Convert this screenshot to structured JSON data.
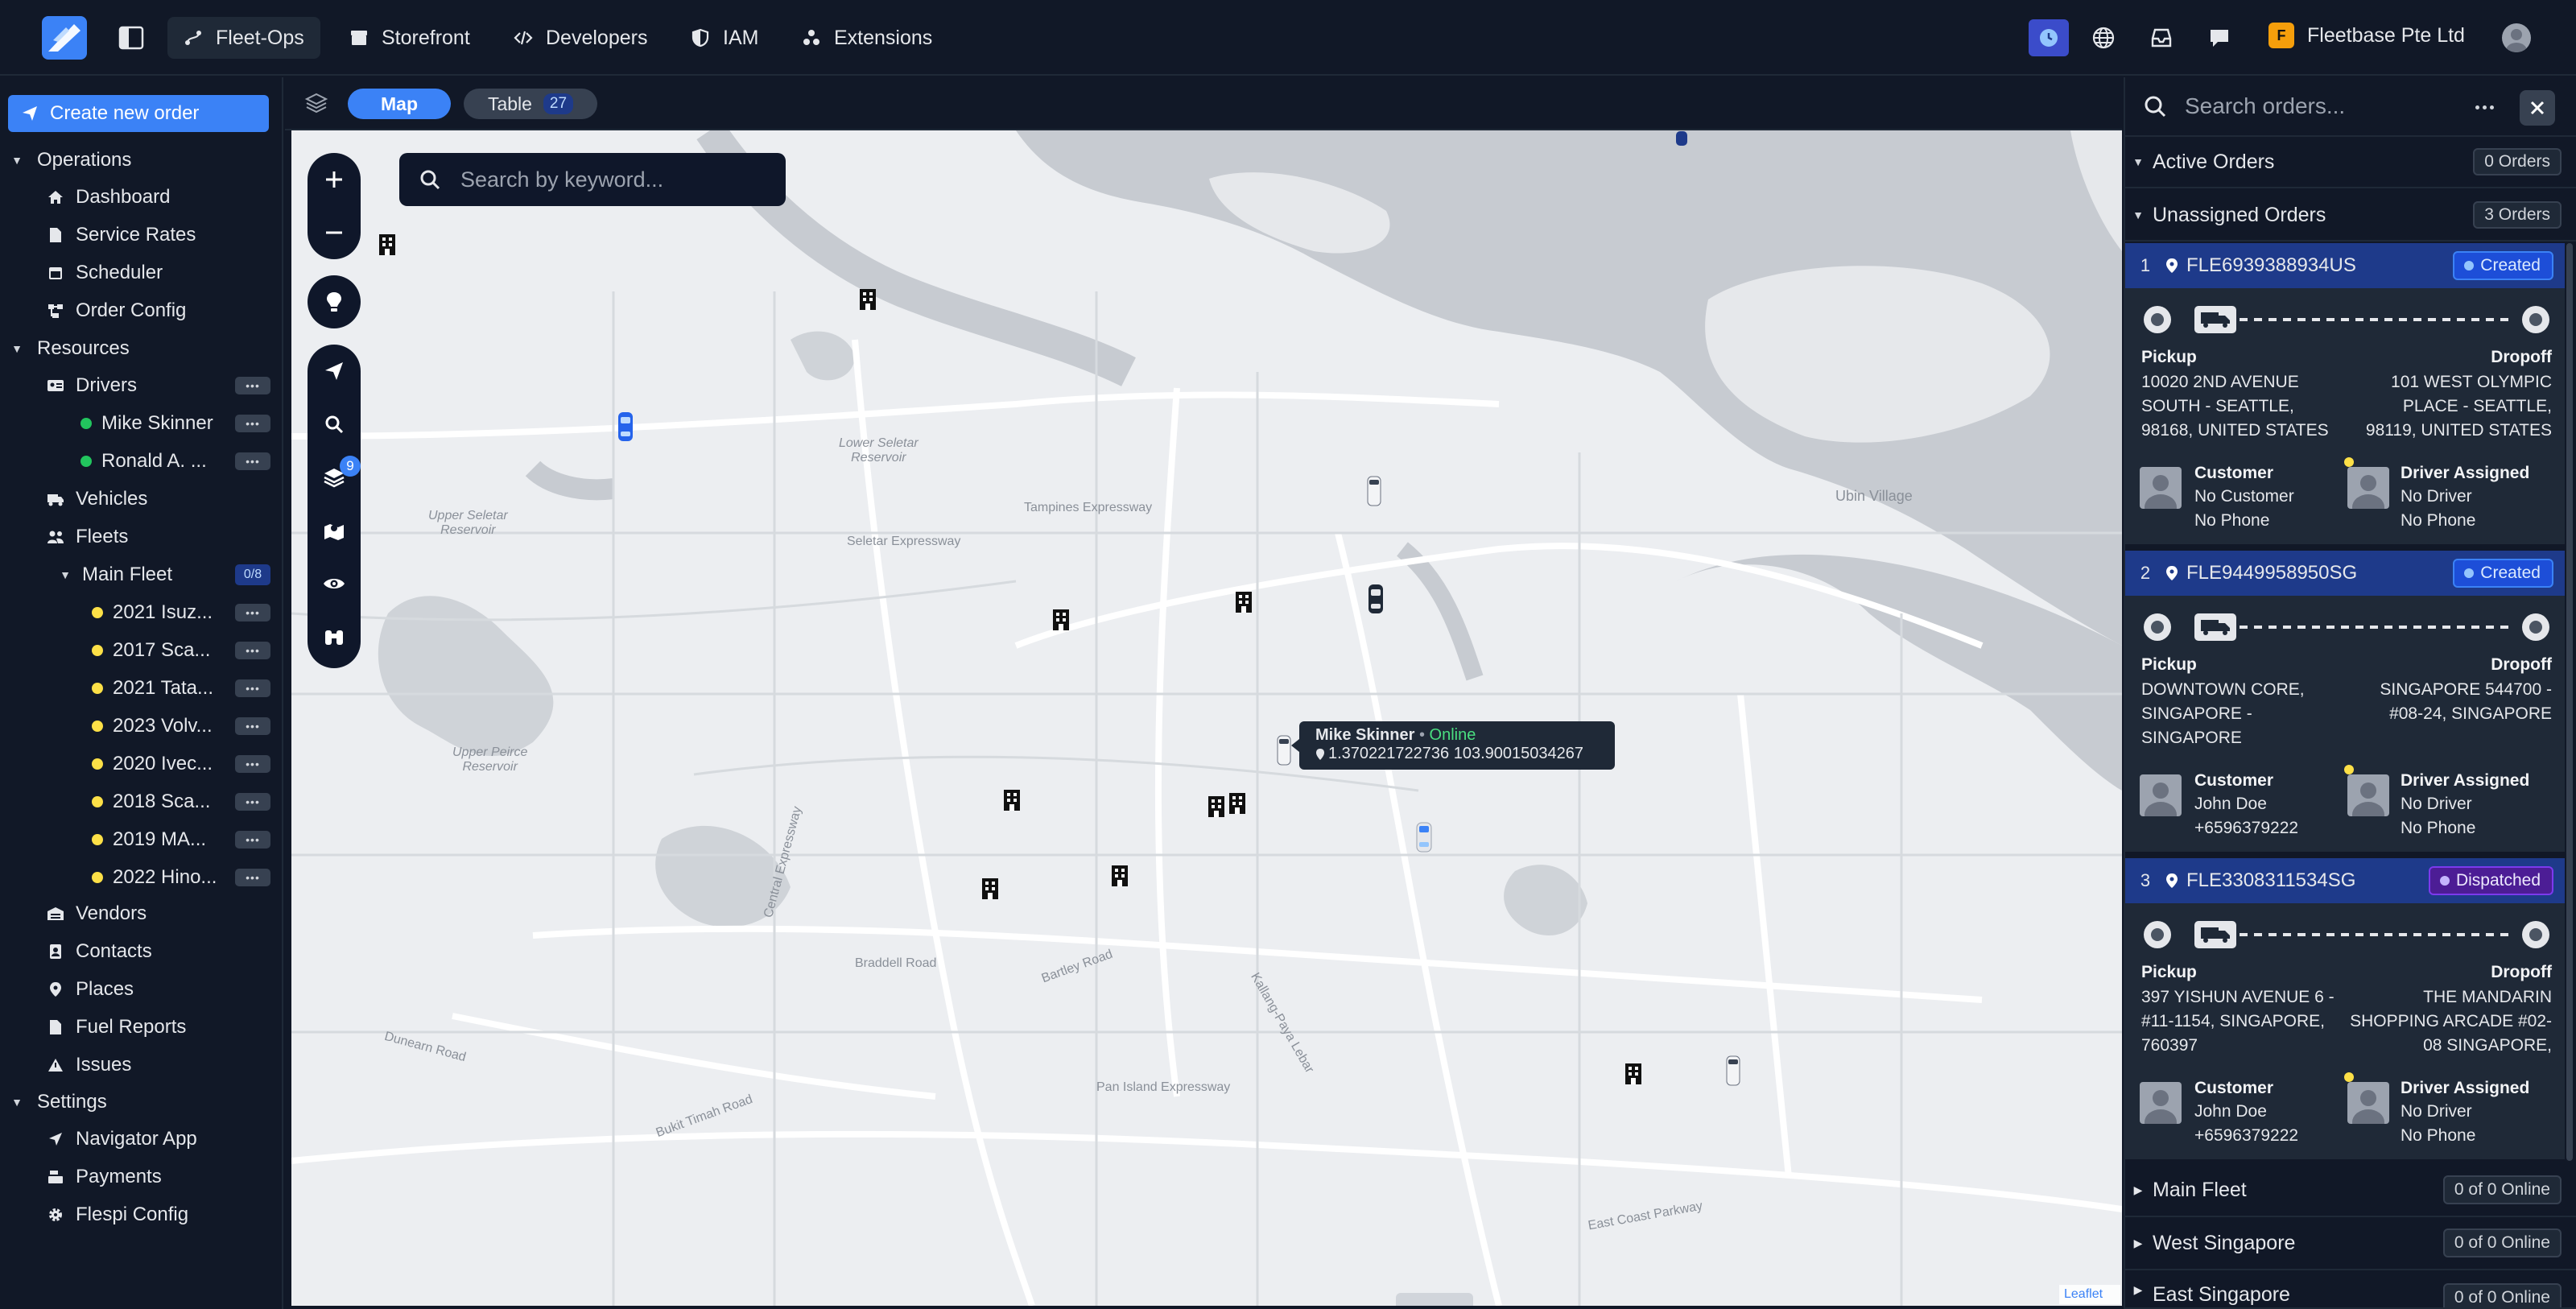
{
  "topbar": {
    "nav": [
      {
        "label": "Fleet-Ops",
        "icon": "route-icon"
      },
      {
        "label": "Storefront",
        "icon": "store-icon"
      },
      {
        "label": "Developers",
        "icon": "code-icon"
      },
      {
        "label": "IAM",
        "icon": "shield-icon"
      },
      {
        "label": "Extensions",
        "icon": "puzzle-icon"
      }
    ],
    "org_initial": "F",
    "org_name": "Fleetbase Pte Ltd"
  },
  "sidebar": {
    "create_label": "Create new order",
    "operations": "Operations",
    "dashboard": "Dashboard",
    "service_rates": "Service Rates",
    "scheduler": "Scheduler",
    "order_config": "Order Config",
    "resources": "Resources",
    "drivers": "Drivers",
    "driver_1": "Mike Skinner",
    "driver_2": "Ronald A. ...",
    "vehicles": "Vehicles",
    "fleets": "Fleets",
    "main_fleet": "Main Fleet",
    "main_fleet_count": "0/8",
    "fleet_vehicles": [
      "2021 Isuz...",
      "2017 Sca...",
      "2021 Tata...",
      "2023 Volv...",
      "2020 Ivec...",
      "2018 Sca...",
      "2019 MA...",
      "2022 Hino..."
    ],
    "vendors": "Vendors",
    "contacts": "Contacts",
    "places": "Places",
    "fuel_reports": "Fuel Reports",
    "issues": "Issues",
    "settings": "Settings",
    "navigator_app": "Navigator App",
    "payments": "Payments",
    "flespi_config": "Flespi Config",
    "more_label": "•••"
  },
  "mapbar": {
    "map_label": "Map",
    "table_label": "Table",
    "table_count": "27"
  },
  "map": {
    "search_placeholder": "Search by keyword...",
    "layers_badge": "9",
    "tooltip_name": "Mike Skinner",
    "tooltip_sep": " • ",
    "tooltip_status": "Online",
    "tooltip_coords": "1.370221722736 103.90015034267",
    "labels": {
      "lower_seletar": "Lower Seletar\nReservoir",
      "upper_seletar": "Upper Seletar\nReservoir",
      "upper_peirce": "Upper Peirce\nReservoir",
      "ubin": "Ubin Village",
      "tampines_exp": "Tampines Expressway",
      "seletar_exp": "Seletar Expressway",
      "central_exp": "Central Expressway",
      "braddell": "Braddell Road",
      "bartley": "Bartley Road",
      "bukit_timah": "Bukit Timah Road",
      "dunearn": "Dunearn Road",
      "pie": "Pan Island Expressway",
      "ecp": "East Coast Parkway",
      "kpe": "Kallang-Paya Lebar"
    },
    "attribution": "Leaflet"
  },
  "panel": {
    "search_placeholder": "Search orders...",
    "active_orders": "Active Orders",
    "active_count": "0 Orders",
    "unassigned_orders": "Unassigned Orders",
    "unassigned_count": "3 Orders",
    "pickup_label": "Pickup",
    "dropoff_label": "Dropoff",
    "customer_label": "Customer",
    "driver_label": "Driver Assigned",
    "orders": [
      {
        "num": "1",
        "id": "FLE6939388934US",
        "status": "Created",
        "pickup": "10020 2ND AVENUE SOUTH - SEATTLE, 98168, UNITED STATES",
        "dropoff": "101 WEST OLYMPIC PLACE - SEATTLE, 98119, UNITED STATES",
        "customer_name": "No Customer",
        "customer_phone": "No Phone",
        "driver_name": "No Driver",
        "driver_phone": "No Phone"
      },
      {
        "num": "2",
        "id": "FLE9449958950SG",
        "status": "Created",
        "pickup": "DOWNTOWN CORE, SINGAPORE - SINGAPORE",
        "dropoff": "SINGAPORE 544700 - #08-24, SINGAPORE",
        "customer_name": "John Doe",
        "customer_phone": "+6596379222",
        "driver_name": "No Driver",
        "driver_phone": "No Phone"
      },
      {
        "num": "3",
        "id": "FLE3308311534SG",
        "status": "Dispatched",
        "pickup": "397 YISHUN AVENUE 6 - #11-1154, SINGAPORE, 760397",
        "dropoff": "THE MANDARIN SHOPPING ARCADE #02-08 SINGAPORE,",
        "customer_name": "John Doe",
        "customer_phone": "+6596379222",
        "driver_name": "No Driver",
        "driver_phone": "No Phone"
      }
    ],
    "fleets": [
      {
        "name": "Main Fleet",
        "status": "0 of 0 Online"
      },
      {
        "name": "West Singapore",
        "status": "0 of 0 Online"
      },
      {
        "name": "East Singapore",
        "status": "0 of 0 Online"
      }
    ]
  },
  "colors": {
    "accent": "#3b82f6",
    "online": "#22c55e",
    "pending": "#fde047"
  }
}
